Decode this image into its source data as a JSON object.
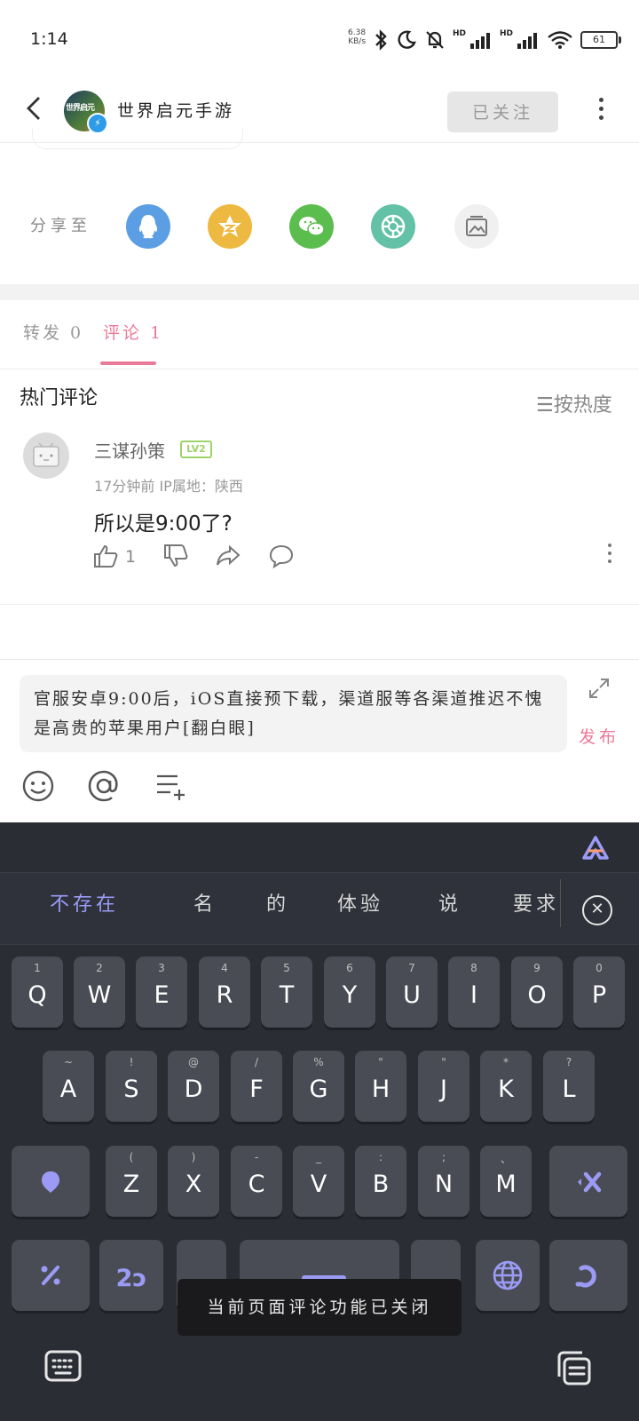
{
  "status_bar": {
    "time": "1:14",
    "speed_value": "6.38",
    "speed_unit": "KB/s",
    "battery": "61",
    "hd1": "HD",
    "hd2": "HD"
  },
  "header": {
    "account_name": "世界启元手游",
    "logo_text": "世界启元",
    "follow_label": "已关注"
  },
  "share": {
    "label": "分享至",
    "colors": {
      "qq": "#5b9ee3",
      "qzone": "#eeb940",
      "wechat": "#5bbd4d",
      "moments": "#62c1a6",
      "image": "#f0f0f0"
    }
  },
  "tabs": [
    {
      "label": "转发 0"
    },
    {
      "label": "评论 1"
    }
  ],
  "comments_section": {
    "title": "热门评论",
    "sort_label": "按热度",
    "comments": [
      {
        "user": "三谋孙策",
        "level": "LV2",
        "meta": "17分钟前  IP属地：陕西",
        "text": "所以是9:00了?",
        "likes": "1"
      }
    ]
  },
  "compose": {
    "text": "官服安卓9:00后，iOS直接预下载，渠道服等各渠道推迟不愧是高贵的苹果用户[翻白眼]",
    "publish_label": "发布"
  },
  "keyboard": {
    "candidates": [
      "不存在",
      "名",
      "的",
      "体验",
      "说",
      "要求"
    ],
    "row1": [
      {
        "hint": "1",
        "key": "Q"
      },
      {
        "hint": "2",
        "key": "W"
      },
      {
        "hint": "3",
        "key": "E"
      },
      {
        "hint": "4",
        "key": "R"
      },
      {
        "hint": "5",
        "key": "T"
      },
      {
        "hint": "6",
        "key": "Y"
      },
      {
        "hint": "7",
        "key": "U"
      },
      {
        "hint": "8",
        "key": "I"
      },
      {
        "hint": "9",
        "key": "O"
      },
      {
        "hint": "0",
        "key": "P"
      }
    ],
    "row2": [
      {
        "hint": "~",
        "key": "A"
      },
      {
        "hint": "!",
        "key": "S"
      },
      {
        "hint": "@",
        "key": "D"
      },
      {
        "hint": "/",
        "key": "F"
      },
      {
        "hint": "%",
        "key": "G"
      },
      {
        "hint": "\"",
        "key": "H"
      },
      {
        "hint": "\"",
        "key": "J"
      },
      {
        "hint": "*",
        "key": "K"
      },
      {
        "hint": "?",
        "key": "L"
      }
    ],
    "row3": [
      {
        "hint": "(",
        "key": "Z"
      },
      {
        "hint": ")",
        "key": "X"
      },
      {
        "hint": "-",
        "key": "C"
      },
      {
        "hint": "_",
        "key": "V"
      },
      {
        "hint": ":",
        "key": "B"
      },
      {
        "hint": ";",
        "key": "N"
      },
      {
        "hint": "、",
        "key": "M"
      }
    ],
    "row4": {
      "comma": ",",
      "period": "。",
      "num_key": "2ↄ"
    },
    "accent": "#9b9bf5"
  },
  "toast": "当前页面评论功能已关闭"
}
